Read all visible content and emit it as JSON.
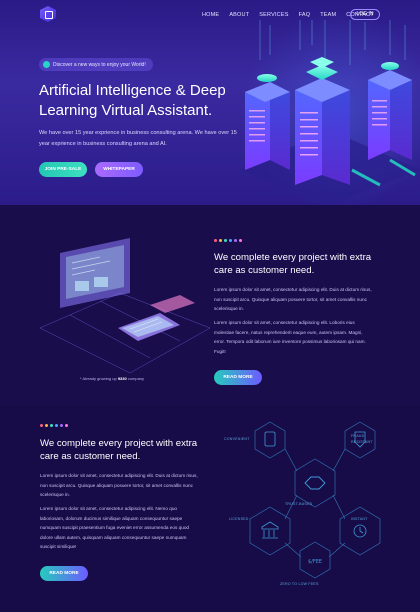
{
  "header": {
    "nav": [
      "HOME",
      "ABOUT",
      "SERVICES",
      "FAQ",
      "TEAM",
      "CONTACT"
    ],
    "login_label": "LOG IN"
  },
  "hero": {
    "pill_text": "Discover a new ways to enjoy your World!",
    "title": "Artificial Intelligence & Deep Learning Virtual Assistant.",
    "description": "We have over 15 year exprience in business consulting arena. We have over 15 year exprience in business consulting arena and AI.",
    "btn_presale": "JOIN PRE-SALE",
    "btn_whitepaper": "WHITEPAPER"
  },
  "section_one": {
    "title": "We complete every project with extra care as customer need.",
    "para1": "Lorem ipsum dolor sit amet, consectetur adipiscing elit. Duis at dictum risus, non suscipit arcu. Quisque aliquam posuere tortor, sit amet convallis nunc scelerisque in.",
    "para2": "Lorem ipsum dolor sit amet, consectetur adipiscing elit. Loboris eius molestiae facere, natus reprehenderit eaque eum, autem ipsam. Magni, error. Tempora odit laborum iure inventore possimus laboriosam qui nam. Fugit!",
    "button": "READ MORE",
    "caption_prefix": "* Already growing up ",
    "caption_count": "9330",
    "caption_suffix": " company"
  },
  "section_two": {
    "title": "We complete every project with extra care as customer need.",
    "para1": "Lorem ipsum dolor sit amet, consectetur adipiscing elit. Duis at dictum risus, non suscipit arcu. Quisque aliquam posuere tortor, sit amet convallis nunc scelerisque in.",
    "para2": "Lorem ipsum dolor sit amet, consectetur adipiscing elit. Nemo quo laboriosam, dolorum ducimus similique aliquam consequuntur saepe numquam suscipit praesentium fuga eveniet error assumenda eos quod dolore ullam autem, quisquam aliquam consequuntur saepe numquam suscipit similique!",
    "button": "READ MORE",
    "features": [
      "CONVENIENT",
      "FRAUD RESISTANT",
      "TRUST-BASED",
      "LICENSED",
      "INSTANT",
      "ZERO TO LOW FEES"
    ]
  },
  "colors": {
    "teal": "#26cbbd",
    "purple": "#7e5bff",
    "dot_colors": [
      "#ff5f7e",
      "#ffb347",
      "#3de0c0",
      "#4fa8ff",
      "#a86bff",
      "#ff7ad9"
    ]
  }
}
